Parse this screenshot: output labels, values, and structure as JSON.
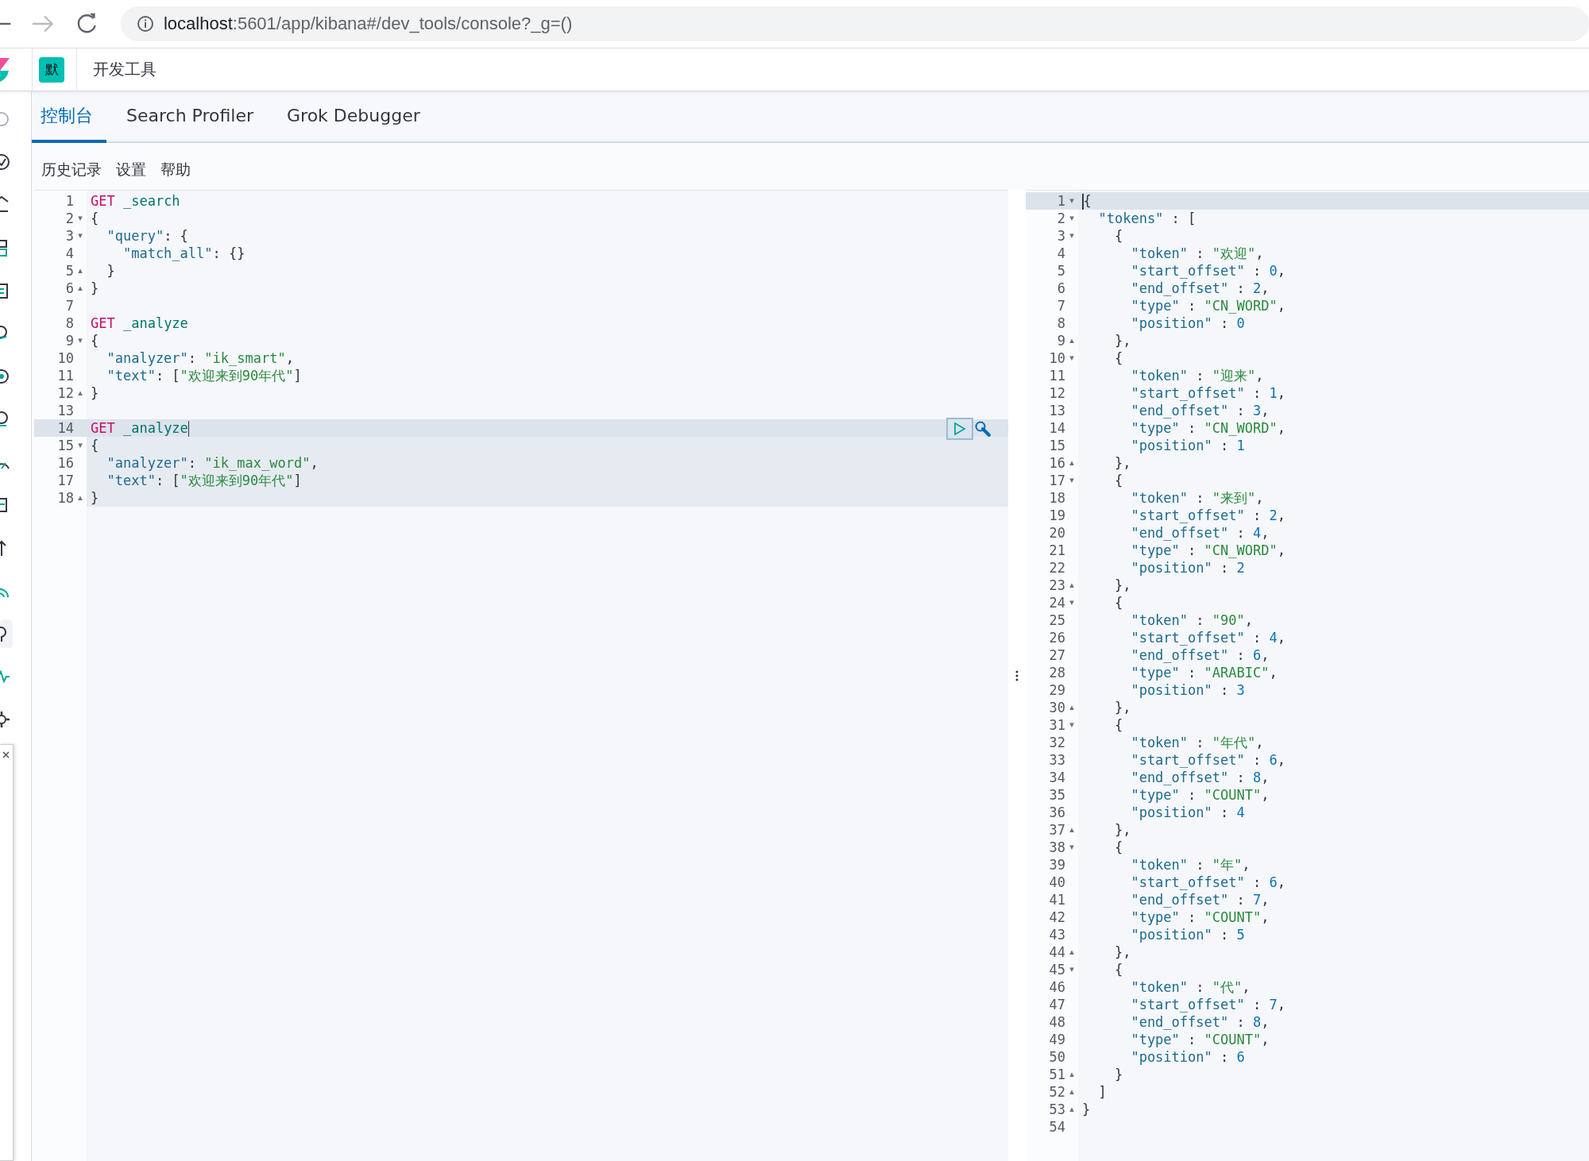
{
  "browser": {
    "url_host": "localhost",
    "url_rest": ":5601/app/kibana#/dev_tools/console?_g=()"
  },
  "header": {
    "space_badge": "默",
    "title": "开发工具"
  },
  "tabs": [
    {
      "label": "控制台",
      "selected": true
    },
    {
      "label": "Search Profiler",
      "selected": false
    },
    {
      "label": "Grok Debugger",
      "selected": false
    }
  ],
  "menu": [
    "历史记录",
    "设置",
    "帮助"
  ],
  "left_editor": {
    "show_actions": true,
    "cursor_at_line_end": true,
    "lines": [
      {
        "number": "1",
        "active": false,
        "in_request": false,
        "tokens": [
          {
            "kind": "method",
            "text": "GET"
          },
          {
            "kind": "path",
            "text": " _search"
          }
        ]
      },
      {
        "number": "2",
        "fold_marker": "▾",
        "active": false,
        "in_request": false,
        "tokens": [
          {
            "kind": "punct",
            "text": "{"
          }
        ]
      },
      {
        "number": "3",
        "fold_marker": "▾",
        "active": false,
        "in_request": false,
        "tokens": [
          {
            "kind": "key",
            "text": "  \"query\""
          },
          {
            "kind": "punct",
            "text": ": {"
          }
        ]
      },
      {
        "number": "4",
        "active": false,
        "in_request": false,
        "tokens": [
          {
            "kind": "key",
            "text": "    \"match_all\""
          },
          {
            "kind": "punct",
            "text": ": {}"
          }
        ]
      },
      {
        "number": "5",
        "fold_marker": "▴",
        "active": false,
        "in_request": false,
        "tokens": [
          {
            "kind": "punct",
            "text": "  }"
          }
        ]
      },
      {
        "number": "6",
        "fold_marker": "▴",
        "active": false,
        "in_request": false,
        "tokens": [
          {
            "kind": "punct",
            "text": "}"
          }
        ]
      },
      {
        "number": "7",
        "active": false,
        "in_request": false
      },
      {
        "number": "8",
        "active": false,
        "in_request": false,
        "tokens": [
          {
            "kind": "method",
            "text": "GET"
          },
          {
            "kind": "path",
            "text": " _analyze"
          }
        ]
      },
      {
        "number": "9",
        "fold_marker": "▾",
        "active": false,
        "in_request": false,
        "tokens": [
          {
            "kind": "punct",
            "text": "{"
          }
        ]
      },
      {
        "number": "10",
        "active": false,
        "in_request": false,
        "tokens": [
          {
            "kind": "key",
            "text": "  \"analyzer\""
          },
          {
            "kind": "punct",
            "text": ": "
          },
          {
            "kind": "string",
            "text": "\"ik_smart\""
          },
          {
            "kind": "punct",
            "text": ","
          }
        ]
      },
      {
        "number": "11",
        "active": false,
        "in_request": false,
        "tokens": [
          {
            "kind": "key",
            "text": "  \"text\""
          },
          {
            "kind": "punct",
            "text": ": ["
          },
          {
            "kind": "string",
            "text": "\"欢迎来到90年代\""
          },
          {
            "kind": "punct",
            "text": "]"
          }
        ]
      },
      {
        "number": "12",
        "fold_marker": "▴",
        "active": false,
        "in_request": false,
        "tokens": [
          {
            "kind": "punct",
            "text": "}"
          }
        ]
      },
      {
        "number": "13",
        "active": false,
        "in_request": false
      },
      {
        "number": "14",
        "active": true,
        "in_request": true,
        "tokens": [
          {
            "kind": "method",
            "text": "GET"
          },
          {
            "kind": "path",
            "text": " _analyze"
          }
        ]
      },
      {
        "number": "15",
        "fold_marker": "▾",
        "active": false,
        "in_request": true,
        "tokens": [
          {
            "kind": "punct",
            "text": "{"
          }
        ]
      },
      {
        "number": "16",
        "active": false,
        "in_request": true,
        "tokens": [
          {
            "kind": "key",
            "text": "  \"analyzer\""
          },
          {
            "kind": "punct",
            "text": ": "
          },
          {
            "kind": "string",
            "text": "\"ik_max_word\""
          },
          {
            "kind": "punct",
            "text": ","
          }
        ]
      },
      {
        "number": "17",
        "active": false,
        "in_request": true,
        "tokens": [
          {
            "kind": "key",
            "text": "  \"text\""
          },
          {
            "kind": "punct",
            "text": ": ["
          },
          {
            "kind": "string",
            "text": "\"欢迎来到90年代\""
          },
          {
            "kind": "punct",
            "text": "]"
          }
        ]
      },
      {
        "number": "18",
        "fold_marker": "▴",
        "active": false,
        "in_request": true,
        "tokens": [
          {
            "kind": "punct",
            "text": "}"
          }
        ]
      }
    ]
  },
  "right_editor": {
    "cursor_at_line_end": false,
    "lines": [
      {
        "number": "1",
        "fold_marker": "▾",
        "active": true,
        "tokens": [
          {
            "kind": "punct",
            "text": "{"
          }
        ]
      },
      {
        "number": "2",
        "fold_marker": "▾",
        "active": false,
        "tokens": [
          {
            "kind": "key",
            "text": "  \"tokens\""
          },
          {
            "kind": "punct",
            "text": " : ["
          }
        ]
      },
      {
        "number": "3",
        "fold_marker": "▾",
        "active": false,
        "tokens": [
          {
            "kind": "punct",
            "text": "    {"
          }
        ]
      },
      {
        "number": "4",
        "active": false,
        "tokens": [
          {
            "kind": "key",
            "text": "      \"token\""
          },
          {
            "kind": "punct",
            "text": " : "
          },
          {
            "kind": "string",
            "text": "\"欢迎\""
          },
          {
            "kind": "punct",
            "text": ","
          }
        ]
      },
      {
        "number": "5",
        "active": false,
        "tokens": [
          {
            "kind": "key",
            "text": "      \"start_offset\""
          },
          {
            "kind": "punct",
            "text": " : "
          },
          {
            "kind": "number",
            "text": "0"
          },
          {
            "kind": "punct",
            "text": ","
          }
        ]
      },
      {
        "number": "6",
        "active": false,
        "tokens": [
          {
            "kind": "key",
            "text": "      \"end_offset\""
          },
          {
            "kind": "punct",
            "text": " : "
          },
          {
            "kind": "number",
            "text": "2"
          },
          {
            "kind": "punct",
            "text": ","
          }
        ]
      },
      {
        "number": "7",
        "active": false,
        "tokens": [
          {
            "kind": "key",
            "text": "      \"type\""
          },
          {
            "kind": "punct",
            "text": " : "
          },
          {
            "kind": "string",
            "text": "\"CN_WORD\""
          },
          {
            "kind": "punct",
            "text": ","
          }
        ]
      },
      {
        "number": "8",
        "active": false,
        "tokens": [
          {
            "kind": "key",
            "text": "      \"position\""
          },
          {
            "kind": "punct",
            "text": " : "
          },
          {
            "kind": "number",
            "text": "0"
          }
        ]
      },
      {
        "number": "9",
        "fold_marker": "▴",
        "active": false,
        "tokens": [
          {
            "kind": "punct",
            "text": "    },"
          }
        ]
      },
      {
        "number": "10",
        "fold_marker": "▾",
        "active": false,
        "tokens": [
          {
            "kind": "punct",
            "text": "    {"
          }
        ]
      },
      {
        "number": "11",
        "active": false,
        "tokens": [
          {
            "kind": "key",
            "text": "      \"token\""
          },
          {
            "kind": "punct",
            "text": " : "
          },
          {
            "kind": "string",
            "text": "\"迎来\""
          },
          {
            "kind": "punct",
            "text": ","
          }
        ]
      },
      {
        "number": "12",
        "active": false,
        "tokens": [
          {
            "kind": "key",
            "text": "      \"start_offset\""
          },
          {
            "kind": "punct",
            "text": " : "
          },
          {
            "kind": "number",
            "text": "1"
          },
          {
            "kind": "punct",
            "text": ","
          }
        ]
      },
      {
        "number": "13",
        "active": false,
        "tokens": [
          {
            "kind": "key",
            "text": "      \"end_offset\""
          },
          {
            "kind": "punct",
            "text": " : "
          },
          {
            "kind": "number",
            "text": "3"
          },
          {
            "kind": "punct",
            "text": ","
          }
        ]
      },
      {
        "number": "14",
        "active": false,
        "tokens": [
          {
            "kind": "key",
            "text": "      \"type\""
          },
          {
            "kind": "punct",
            "text": " : "
          },
          {
            "kind": "string",
            "text": "\"CN_WORD\""
          },
          {
            "kind": "punct",
            "text": ","
          }
        ]
      },
      {
        "number": "15",
        "active": false,
        "tokens": [
          {
            "kind": "key",
            "text": "      \"position\""
          },
          {
            "kind": "punct",
            "text": " : "
          },
          {
            "kind": "number",
            "text": "1"
          }
        ]
      },
      {
        "number": "16",
        "fold_marker": "▴",
        "active": false,
        "tokens": [
          {
            "kind": "punct",
            "text": "    },"
          }
        ]
      },
      {
        "number": "17",
        "fold_marker": "▾",
        "active": false,
        "tokens": [
          {
            "kind": "punct",
            "text": "    {"
          }
        ]
      },
      {
        "number": "18",
        "active": false,
        "tokens": [
          {
            "kind": "key",
            "text": "      \"token\""
          },
          {
            "kind": "punct",
            "text": " : "
          },
          {
            "kind": "string",
            "text": "\"来到\""
          },
          {
            "kind": "punct",
            "text": ","
          }
        ]
      },
      {
        "number": "19",
        "active": false,
        "tokens": [
          {
            "kind": "key",
            "text": "      \"start_offset\""
          },
          {
            "kind": "punct",
            "text": " : "
          },
          {
            "kind": "number",
            "text": "2"
          },
          {
            "kind": "punct",
            "text": ","
          }
        ]
      },
      {
        "number": "20",
        "active": false,
        "tokens": [
          {
            "kind": "key",
            "text": "      \"end_offset\""
          },
          {
            "kind": "punct",
            "text": " : "
          },
          {
            "kind": "number",
            "text": "4"
          },
          {
            "kind": "punct",
            "text": ","
          }
        ]
      },
      {
        "number": "21",
        "active": false,
        "tokens": [
          {
            "kind": "key",
            "text": "      \"type\""
          },
          {
            "kind": "punct",
            "text": " : "
          },
          {
            "kind": "string",
            "text": "\"CN_WORD\""
          },
          {
            "kind": "punct",
            "text": ","
          }
        ]
      },
      {
        "number": "22",
        "active": false,
        "tokens": [
          {
            "kind": "key",
            "text": "      \"position\""
          },
          {
            "kind": "punct",
            "text": " : "
          },
          {
            "kind": "number",
            "text": "2"
          }
        ]
      },
      {
        "number": "23",
        "fold_marker": "▴",
        "active": false,
        "tokens": [
          {
            "kind": "punct",
            "text": "    },"
          }
        ]
      },
      {
        "number": "24",
        "fold_marker": "▾",
        "active": false,
        "tokens": [
          {
            "kind": "punct",
            "text": "    {"
          }
        ]
      },
      {
        "number": "25",
        "active": false,
        "tokens": [
          {
            "kind": "key",
            "text": "      \"token\""
          },
          {
            "kind": "punct",
            "text": " : "
          },
          {
            "kind": "string",
            "text": "\"90\""
          },
          {
            "kind": "punct",
            "text": ","
          }
        ]
      },
      {
        "number": "26",
        "active": false,
        "tokens": [
          {
            "kind": "key",
            "text": "      \"start_offset\""
          },
          {
            "kind": "punct",
            "text": " : "
          },
          {
            "kind": "number",
            "text": "4"
          },
          {
            "kind": "punct",
            "text": ","
          }
        ]
      },
      {
        "number": "27",
        "active": false,
        "tokens": [
          {
            "kind": "key",
            "text": "      \"end_offset\""
          },
          {
            "kind": "punct",
            "text": " : "
          },
          {
            "kind": "number",
            "text": "6"
          },
          {
            "kind": "punct",
            "text": ","
          }
        ]
      },
      {
        "number": "28",
        "active": false,
        "tokens": [
          {
            "kind": "key",
            "text": "      \"type\""
          },
          {
            "kind": "punct",
            "text": " : "
          },
          {
            "kind": "string",
            "text": "\"ARABIC\""
          },
          {
            "kind": "punct",
            "text": ","
          }
        ]
      },
      {
        "number": "29",
        "active": false,
        "tokens": [
          {
            "kind": "key",
            "text": "      \"position\""
          },
          {
            "kind": "punct",
            "text": " : "
          },
          {
            "kind": "number",
            "text": "3"
          }
        ]
      },
      {
        "number": "30",
        "fold_marker": "▴",
        "active": false,
        "tokens": [
          {
            "kind": "punct",
            "text": "    },"
          }
        ]
      },
      {
        "number": "31",
        "fold_marker": "▾",
        "active": false,
        "tokens": [
          {
            "kind": "punct",
            "text": "    {"
          }
        ]
      },
      {
        "number": "32",
        "active": false,
        "tokens": [
          {
            "kind": "key",
            "text": "      \"token\""
          },
          {
            "kind": "punct",
            "text": " : "
          },
          {
            "kind": "string",
            "text": "\"年代\""
          },
          {
            "kind": "punct",
            "text": ","
          }
        ]
      },
      {
        "number": "33",
        "active": false,
        "tokens": [
          {
            "kind": "key",
            "text": "      \"start_offset\""
          },
          {
            "kind": "punct",
            "text": " : "
          },
          {
            "kind": "number",
            "text": "6"
          },
          {
            "kind": "punct",
            "text": ","
          }
        ]
      },
      {
        "number": "34",
        "active": false,
        "tokens": [
          {
            "kind": "key",
            "text": "      \"end_offset\""
          },
          {
            "kind": "punct",
            "text": " : "
          },
          {
            "kind": "number",
            "text": "8"
          },
          {
            "kind": "punct",
            "text": ","
          }
        ]
      },
      {
        "number": "35",
        "active": false,
        "tokens": [
          {
            "kind": "key",
            "text": "      \"type\""
          },
          {
            "kind": "punct",
            "text": " : "
          },
          {
            "kind": "string",
            "text": "\"COUNT\""
          },
          {
            "kind": "punct",
            "text": ","
          }
        ]
      },
      {
        "number": "36",
        "active": false,
        "tokens": [
          {
            "kind": "key",
            "text": "      \"position\""
          },
          {
            "kind": "punct",
            "text": " : "
          },
          {
            "kind": "number",
            "text": "4"
          }
        ]
      },
      {
        "number": "37",
        "fold_marker": "▴",
        "active": false,
        "tokens": [
          {
            "kind": "punct",
            "text": "    },"
          }
        ]
      },
      {
        "number": "38",
        "fold_marker": "▾",
        "active": false,
        "tokens": [
          {
            "kind": "punct",
            "text": "    {"
          }
        ]
      },
      {
        "number": "39",
        "active": false,
        "tokens": [
          {
            "kind": "key",
            "text": "      \"token\""
          },
          {
            "kind": "punct",
            "text": " : "
          },
          {
            "kind": "string",
            "text": "\"年\""
          },
          {
            "kind": "punct",
            "text": ","
          }
        ]
      },
      {
        "number": "40",
        "active": false,
        "tokens": [
          {
            "kind": "key",
            "text": "      \"start_offset\""
          },
          {
            "kind": "punct",
            "text": " : "
          },
          {
            "kind": "number",
            "text": "6"
          },
          {
            "kind": "punct",
            "text": ","
          }
        ]
      },
      {
        "number": "41",
        "active": false,
        "tokens": [
          {
            "kind": "key",
            "text": "      \"end_offset\""
          },
          {
            "kind": "punct",
            "text": " : "
          },
          {
            "kind": "number",
            "text": "7"
          },
          {
            "kind": "punct",
            "text": ","
          }
        ]
      },
      {
        "number": "42",
        "active": false,
        "tokens": [
          {
            "kind": "key",
            "text": "      \"type\""
          },
          {
            "kind": "punct",
            "text": " : "
          },
          {
            "kind": "string",
            "text": "\"COUNT\""
          },
          {
            "kind": "punct",
            "text": ","
          }
        ]
      },
      {
        "number": "43",
        "active": false,
        "tokens": [
          {
            "kind": "key",
            "text": "      \"position\""
          },
          {
            "kind": "punct",
            "text": " : "
          },
          {
            "kind": "number",
            "text": "5"
          }
        ]
      },
      {
        "number": "44",
        "fold_marker": "▴",
        "active": false,
        "tokens": [
          {
            "kind": "punct",
            "text": "    },"
          }
        ]
      },
      {
        "number": "45",
        "fold_marker": "▾",
        "active": false,
        "tokens": [
          {
            "kind": "punct",
            "text": "    {"
          }
        ]
      },
      {
        "number": "46",
        "active": false,
        "tokens": [
          {
            "kind": "key",
            "text": "      \"token\""
          },
          {
            "kind": "punct",
            "text": " : "
          },
          {
            "kind": "string",
            "text": "\"代\""
          },
          {
            "kind": "punct",
            "text": ","
          }
        ]
      },
      {
        "number": "47",
        "active": false,
        "tokens": [
          {
            "kind": "key",
            "text": "      \"start_offset\""
          },
          {
            "kind": "punct",
            "text": " : "
          },
          {
            "kind": "number",
            "text": "7"
          },
          {
            "kind": "punct",
            "text": ","
          }
        ]
      },
      {
        "number": "48",
        "active": false,
        "tokens": [
          {
            "kind": "key",
            "text": "      \"end_offset\""
          },
          {
            "kind": "punct",
            "text": " : "
          },
          {
            "kind": "number",
            "text": "8"
          },
          {
            "kind": "punct",
            "text": ","
          }
        ]
      },
      {
        "number": "49",
        "active": false,
        "tokens": [
          {
            "kind": "key",
            "text": "      \"type\""
          },
          {
            "kind": "punct",
            "text": " : "
          },
          {
            "kind": "string",
            "text": "\"COUNT\""
          },
          {
            "kind": "punct",
            "text": ","
          }
        ]
      },
      {
        "number": "50",
        "active": false,
        "tokens": [
          {
            "kind": "key",
            "text": "      \"position\""
          },
          {
            "kind": "punct",
            "text": " : "
          },
          {
            "kind": "number",
            "text": "6"
          }
        ]
      },
      {
        "number": "51",
        "fold_marker": "▴",
        "active": false,
        "tokens": [
          {
            "kind": "punct",
            "text": "    }"
          }
        ]
      },
      {
        "number": "52",
        "fold_marker": "▴",
        "active": false,
        "tokens": [
          {
            "kind": "punct",
            "text": "  ]"
          }
        ]
      },
      {
        "number": "53",
        "fold_marker": "▴",
        "active": false,
        "tokens": [
          {
            "kind": "punct",
            "text": "}"
          }
        ]
      },
      {
        "number": "54",
        "active": false
      }
    ]
  }
}
